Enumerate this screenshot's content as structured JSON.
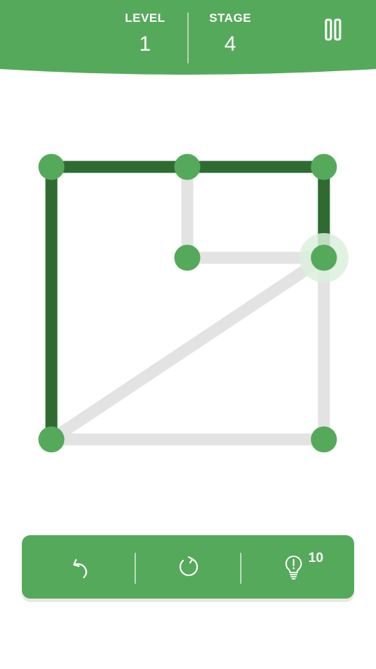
{
  "header": {
    "level_label": "LEVEL",
    "level_value": "1",
    "stage_label": "STAGE",
    "stage_value": "4",
    "pause_icon": "pause-icon"
  },
  "colors": {
    "primary": "#55a95b",
    "drawn_line": "#2f6b30",
    "undrawn_line": "#e3e3e3",
    "node": "#55a95b",
    "active_node_glow": "#dceedd",
    "background": "#ffffff"
  },
  "puzzle": {
    "nodes": [
      {
        "id": "A",
        "col": 0,
        "row": 0
      },
      {
        "id": "B",
        "col": 1,
        "row": 0
      },
      {
        "id": "C",
        "col": 2,
        "row": 0
      },
      {
        "id": "D",
        "col": 1,
        "row": 1
      },
      {
        "id": "E",
        "col": 2,
        "row": 1,
        "active": true
      },
      {
        "id": "F",
        "col": 0,
        "row": 3
      },
      {
        "id": "G",
        "col": 2,
        "row": 3
      }
    ],
    "edges": [
      {
        "from": "A",
        "to": "B",
        "drawn": true
      },
      {
        "from": "B",
        "to": "C",
        "drawn": true
      },
      {
        "from": "C",
        "to": "E",
        "drawn": true
      },
      {
        "from": "A",
        "to": "F",
        "drawn": true
      },
      {
        "from": "B",
        "to": "D",
        "drawn": false
      },
      {
        "from": "D",
        "to": "E",
        "drawn": false
      },
      {
        "from": "E",
        "to": "F",
        "drawn": false
      },
      {
        "from": "E",
        "to": "G",
        "drawn": false
      },
      {
        "from": "F",
        "to": "G",
        "drawn": false
      }
    ]
  },
  "toolbar": {
    "undo_icon": "undo-icon",
    "restart_icon": "restart-icon",
    "hint_icon": "lightbulb-hint-icon",
    "hint_count": "10"
  }
}
